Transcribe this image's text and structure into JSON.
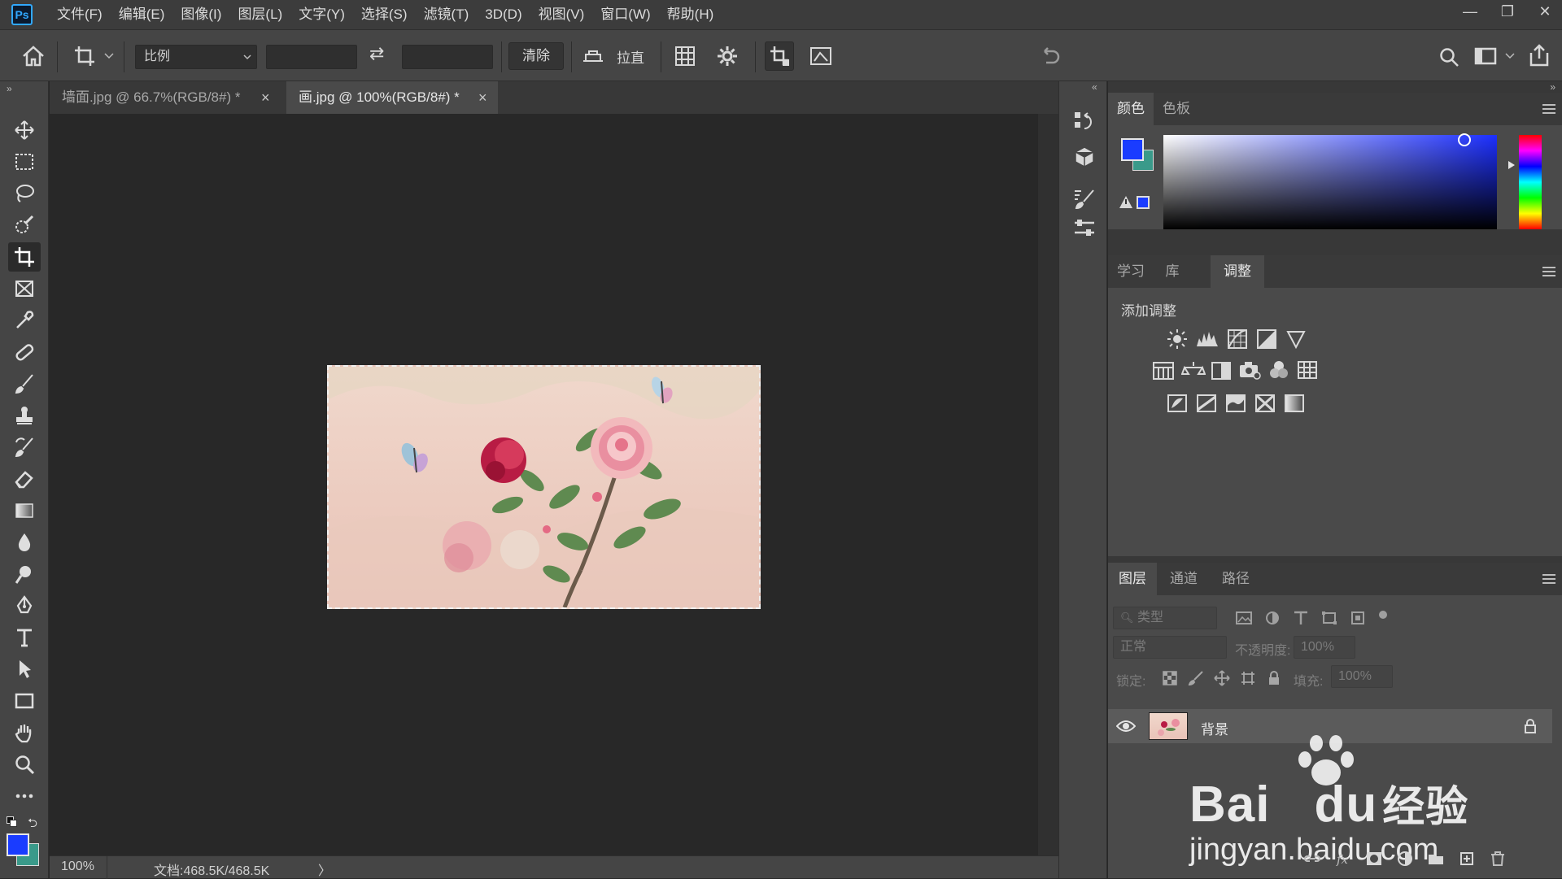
{
  "app": {
    "logo": "Ps"
  },
  "menubar": {
    "items": [
      "文件(F)",
      "编辑(E)",
      "图像(I)",
      "图层(L)",
      "文字(Y)",
      "选择(S)",
      "滤镜(T)",
      "3D(D)",
      "视图(V)",
      "窗口(W)",
      "帮助(H)"
    ]
  },
  "window_controls": {
    "minimize": "—",
    "restore": "❐",
    "close": "✕"
  },
  "options": {
    "ratio_select": "比例",
    "width_value": "",
    "height_value": "",
    "swap_icon": "⇄",
    "clear_label": "清除",
    "straighten_label": "拉直"
  },
  "tabs": [
    {
      "label": "墙面.jpg @ 66.7%(RGB/8#) *",
      "active": false
    },
    {
      "label": "画.jpg @ 100%(RGB/8#) *",
      "active": true
    }
  ],
  "tab_close_glyph": "×",
  "status": {
    "zoom": "100%",
    "doc": "文档:468.5K/468.5K",
    "arrow": "〉"
  },
  "panels": {
    "color": {
      "tabs": [
        "颜色",
        "色板"
      ],
      "active": "颜色"
    },
    "adjust": {
      "tabs": [
        "学习",
        "库",
        "调整"
      ],
      "active": "调整",
      "title": "添加调整"
    },
    "layers": {
      "tabs": [
        "图层",
        "通道",
        "路径"
      ],
      "active": "图层",
      "filter_placeholder": "类型",
      "blend_mode": "正常",
      "opacity_label": "不透明度:",
      "opacity_value": "100%",
      "lock_label": "锁定:",
      "fill_label": "填充:",
      "fill_value": "100%",
      "layer_name": "背景"
    }
  },
  "watermark": {
    "brand": "Bai",
    "brand2": "du",
    "cn": "经验",
    "url": "jingyan.baidu.com"
  },
  "colors": {
    "foreground": "#1a3cff",
    "background": "#3a9a8a",
    "accent": "#31a8ff"
  }
}
